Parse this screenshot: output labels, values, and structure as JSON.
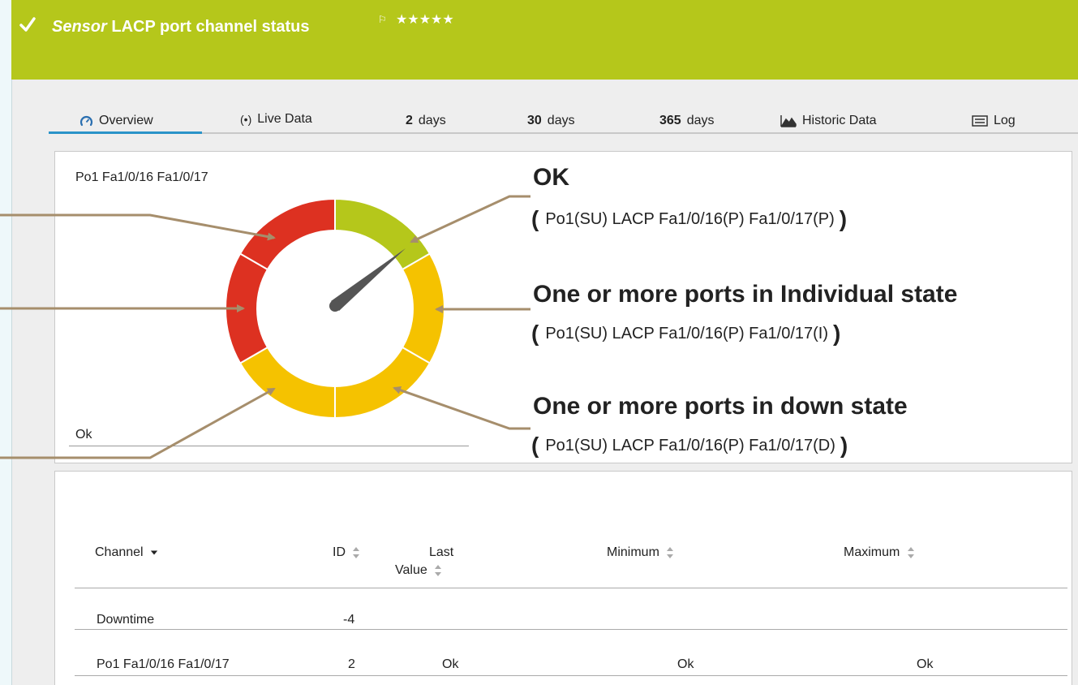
{
  "header": {
    "prefix": "Sensor",
    "title": "LACP port channel status",
    "stars": "★★★★★",
    "status_color": "#b5c71b"
  },
  "tabs": [
    {
      "label": "Overview",
      "icon": "gauge-icon",
      "active": true
    },
    {
      "label": "Live Data",
      "icon": "live-signal-icon"
    },
    {
      "num": "2",
      "label": "days"
    },
    {
      "num": "30",
      "label": "days"
    },
    {
      "num": "365",
      "label": "days"
    },
    {
      "label": "Historic Data",
      "icon": "area-chart-icon"
    },
    {
      "label": "Log",
      "icon": "list-icon"
    }
  ],
  "gauge": {
    "channel_label": "Po1 Fa1/0/16 Fa1/0/17",
    "value_text": "Ok",
    "colors": {
      "green": "#b5c71b",
      "red": "#dd3121",
      "yellow": "#f5c200"
    }
  },
  "annotations": [
    {
      "title": "OK",
      "detail": "Po1(SU) LACP Fa1/0/16(P) Fa1/0/17(P)"
    },
    {
      "title": "One or more ports in Individual state",
      "detail": "Po1(SU) LACP Fa1/0/16(P) Fa1/0/17(I)"
    },
    {
      "title": "One or more ports in down state",
      "detail": "Po1(SU) LACP Fa1/0/16(P) Fa1/0/17(D)"
    }
  ],
  "table": {
    "headers": {
      "channel": "Channel",
      "id": "ID",
      "last_value_1": "Last",
      "last_value_2": "Value",
      "minimum": "Minimum",
      "maximum": "Maximum"
    },
    "rows": [
      {
        "channel": "Downtime",
        "id": "-4",
        "last": "",
        "min": "",
        "max": ""
      },
      {
        "channel": "Po1 Fa1/0/16 Fa1/0/17",
        "id": "2",
        "last": "Ok",
        "min": "Ok",
        "max": "Ok"
      }
    ]
  }
}
